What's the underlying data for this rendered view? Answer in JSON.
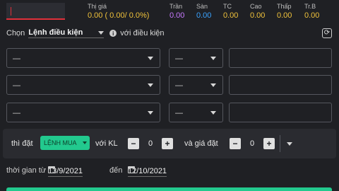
{
  "quote": {
    "headers": {
      "price": "Thị giá",
      "ceiling": "Trần",
      "floor": "Sàn",
      "reference": "TC",
      "high": "Cao",
      "low": "Thấp",
      "average": "Tr.B"
    },
    "values": {
      "price": "0.00 ( 0.00/ 0.0%)",
      "ceiling": "0.00",
      "floor": "0.00",
      "reference": "0.00",
      "high": "0.00",
      "low": "0.00",
      "average": "0.00"
    }
  },
  "choose": {
    "prefix": "Chọn",
    "selected": "Lệnh điều kiện",
    "suffix": "với điều kiện"
  },
  "conditions": [
    {
      "field": "—",
      "operator": "—",
      "value": ""
    },
    {
      "field": "—",
      "operator": "—",
      "value": ""
    },
    {
      "field": "—",
      "operator": "—",
      "value": ""
    }
  ],
  "order": {
    "then_label": "thì đặt",
    "side": "LỆNH MUA",
    "qty_label": "với KL",
    "qty_value": "0",
    "price_label": "và giá đặt",
    "price_value": "0",
    "minus": "−",
    "plus": "+"
  },
  "dates": {
    "from_label": "thời gian từ",
    "from_value": "13/9/2021",
    "to_label": "đến",
    "to_value": "12/10/2021"
  },
  "colors": {
    "accent": "#22c98e",
    "price_up": "#f0c23b",
    "ceiling": "#c779ff",
    "floor": "#3aa3ff",
    "error": "#e0303a"
  }
}
